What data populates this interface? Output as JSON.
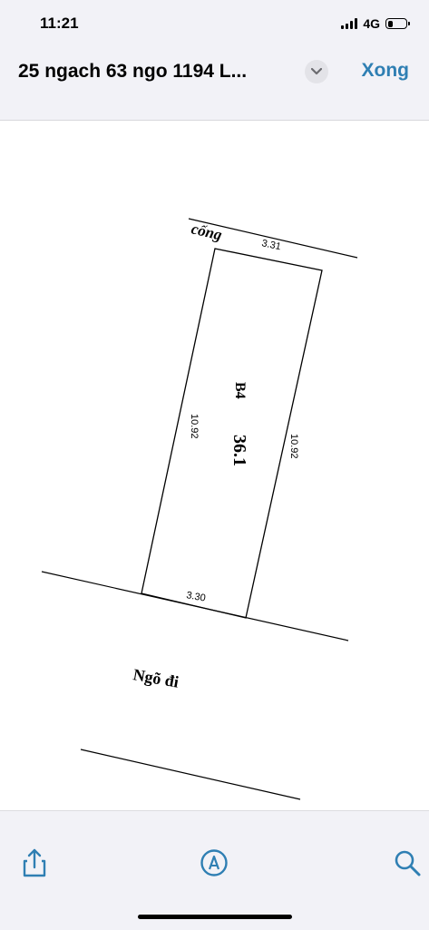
{
  "status_bar": {
    "time": "11:21",
    "network": "4G",
    "signal_bars": 4,
    "battery_level": 0.3
  },
  "nav": {
    "title": "25 ngach 63 ngo 1194 L...",
    "done_label": "Xong",
    "menu_icon": "chevron-down-icon",
    "accent_color": "#2f7fb3"
  },
  "drawing": {
    "top_label": "cống",
    "plot_id": "B4",
    "area": "36.1",
    "top_width": "3.31",
    "bottom_width": "3.30",
    "left_length": "10.92",
    "right_length": "10.92",
    "road_label": "Ngõ đi"
  },
  "toolbar": {
    "share_icon": "share-icon",
    "markup_icon": "markup-icon",
    "search_icon": "search-icon"
  }
}
